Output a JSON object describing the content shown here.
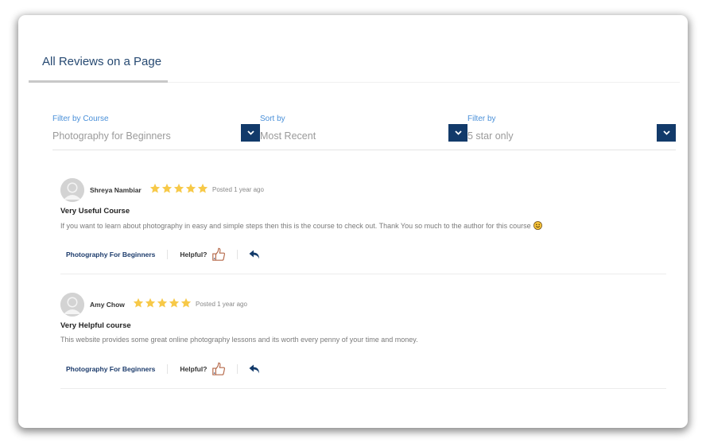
{
  "tabs": [
    {
      "label": "All Reviews on a Page",
      "active": true
    }
  ],
  "filters": [
    {
      "label": "Filter by Course",
      "value": "Photography for Beginners"
    },
    {
      "label": "Sort by",
      "value": "Most Recent"
    },
    {
      "label": "Filter by",
      "value": "5 star only"
    }
  ],
  "colors": {
    "accent": "#123a6a",
    "star": "#f7c948",
    "label_blue": "#4a90d9",
    "thumb": "#b5694a"
  },
  "reviews": [
    {
      "author": "Shreya Nambiar",
      "rating": 5,
      "posted": "Posted 1 year ago",
      "title": "Very Useful Course",
      "body": "If you want to learn about photography in easy and simple steps then this is the course to check out. Thank You so much to the author for this course",
      "has_emoji": true,
      "course": "Photography For Beginners",
      "helpful_label": "Helpful?"
    },
    {
      "author": "Amy Chow",
      "rating": 5,
      "posted": "Posted 1 year ago",
      "title": "Very Helpful course",
      "body": "This website provides some great online photography lessons and its worth every penny of your time and money.",
      "has_emoji": false,
      "course": "Photography For Beginners",
      "helpful_label": "Helpful?"
    }
  ]
}
